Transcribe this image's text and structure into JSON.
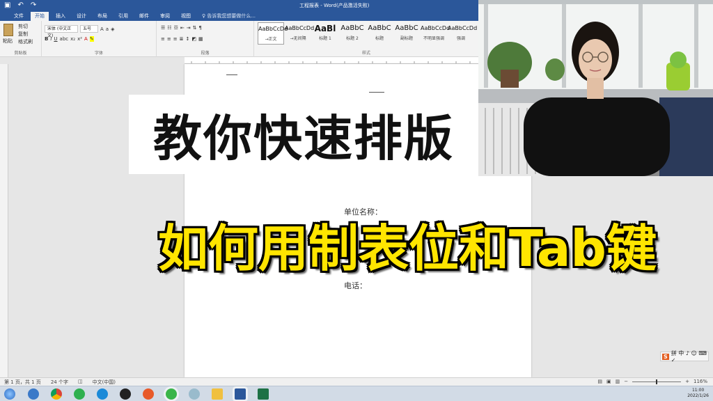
{
  "titlebar": {
    "title": "工程报表 - Word(产品激活失败)",
    "undo_glyph": "↶",
    "redo_glyph": "↷",
    "save_glyph": "▣"
  },
  "tabs": [
    "文件",
    "开始",
    "插入",
    "设计",
    "布局",
    "引用",
    "邮件",
    "审阅",
    "视图"
  ],
  "tabs_active": "开始",
  "tell_me": "♀ 告诉我您想要做什么...",
  "ribbon": {
    "clipboard": {
      "paste": "粘贴",
      "cut": "剪切",
      "copy": "复制",
      "format_painter": "格式刷",
      "label": "剪贴板"
    },
    "font": {
      "family": "宋体 (中文正文)",
      "size": "五号",
      "label": "字体"
    },
    "paragraph": {
      "label": "段落"
    },
    "styles": {
      "label": "样式",
      "items": [
        {
          "sample": "AaBbCcDd",
          "name": "→正文"
        },
        {
          "sample": "AaBbCcDd",
          "name": "→无间隔"
        },
        {
          "sample": "AaBl",
          "name": "标题 1"
        },
        {
          "sample": "AaBbC",
          "name": "标题 2"
        },
        {
          "sample": "AaBbC",
          "name": "标题"
        },
        {
          "sample": "AaBbC",
          "name": "副标题"
        },
        {
          "sample": "AaBbCcDd",
          "name": "不明显强调"
        },
        {
          "sample": "AaBbCcDd",
          "name": "强调"
        }
      ]
    }
  },
  "document": {
    "line1": "单位名称：",
    "line2": "电话："
  },
  "overlay": {
    "banner1": "教你快速排版",
    "banner2": "如何用制表位和Tab键"
  },
  "statusbar": {
    "page": "第 1 页，共 1 页",
    "words": "24 个字",
    "lang": "中文(中国)",
    "zoom": "116%",
    "zoom_minus": "−",
    "zoom_plus": "+"
  },
  "ime": {
    "logo": "S",
    "text": "拼 中 ♪ ☺ ⌨ ✓"
  },
  "clock": {
    "time": "11:00",
    "date": "2022/1/26"
  },
  "colors": {
    "word_blue": "#2b579a",
    "banner_yellow": "#ffe500",
    "excel_green": "#1e7145"
  }
}
